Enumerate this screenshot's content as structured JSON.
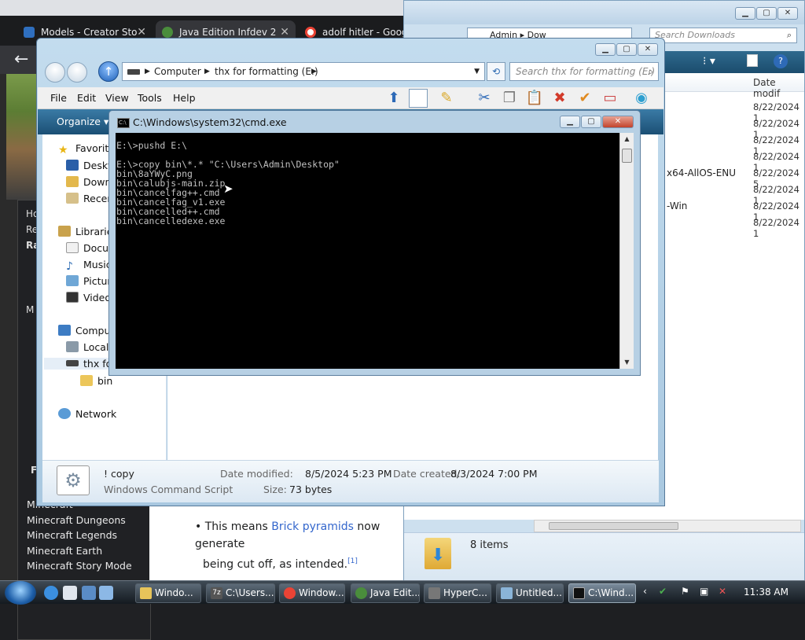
{
  "browser": {
    "tabs": [
      {
        "title": "Models - Creator Sto",
        "color": "#2f6fbf"
      },
      {
        "title": "Java Edition Infdev 2",
        "color": "#4a8d3c"
      },
      {
        "title": "adolf hitler - Googl",
        "color": "#ea4335"
      }
    ],
    "sidebar_fragments": [
      "Ho",
      "Re",
      "Ra",
      "M",
      "F"
    ],
    "sidebar_links": [
      "Minecraft",
      "Minecraft Dungeons",
      "Minecraft Legends",
      "Minecraft Earth",
      "Minecraft Story Mode"
    ],
    "article": {
      "bullet_prefix": "This means ",
      "link": "Brick pyramids",
      "bullet_suffix": " now generate",
      "line2": "being cut off, as intended.",
      "ref": "[1]"
    }
  },
  "downloads": {
    "address": [
      "Admin",
      "Dow"
    ],
    "search_placeholder": "Search Downloads",
    "column_date": "Date modif",
    "dates": [
      "8/22/2024 1",
      "8/22/2024 1",
      "8/22/2024 1",
      "8/22/2024 1",
      "8/22/2024 5",
      "8/22/2024 1",
      "8/22/2024 1",
      "8/22/2024 1"
    ],
    "name_fragments": {
      "row5": "x64-AllOS-ENU",
      "row7": "-Win"
    },
    "status": "8 items"
  },
  "explorer": {
    "breadcrumb": [
      "Computer",
      "thx for formatting (E:)"
    ],
    "search_placeholder": "Search thx for formatting (E:)",
    "menu": [
      "File",
      "Edit",
      "View",
      "Tools",
      "Help"
    ],
    "organize": "Organize",
    "nav": {
      "favorites": "Favorites",
      "favorites_items": [
        "Desktop",
        "Downloads",
        "Recent Places"
      ],
      "libraries": "Libraries",
      "libraries_items": [
        "Documents",
        "Music",
        "Pictures",
        "Videos"
      ],
      "computer": "Computer",
      "computer_items": [
        "Local Disk (C:)",
        "thx for formatting (E:)"
      ],
      "folder": "bin",
      "network": "Network"
    },
    "details": {
      "name": "! copy",
      "type": "Windows Command Script",
      "modified_label": "Date modified:",
      "modified_value": "8/5/2024 5:23 PM",
      "created_label": "Date created:",
      "created_value": "8/3/2024 7:00 PM",
      "size_label": "Size:",
      "size_value": "73 bytes"
    }
  },
  "cmd": {
    "title": "C:\\Windows\\system32\\cmd.exe",
    "lines": [
      "E:\\>pushd E:\\",
      "",
      "E:\\>copy bin\\*.* \"C:\\Users\\Admin\\Desktop\"",
      "bin\\8aYWyC.png",
      "bin\\calubjs-main.zip",
      "bin\\cancelfag++.cmd",
      "bin\\cancelfag_v1.exe",
      "bin\\cancelled++.cmd",
      "bin\\cancelledexe.exe"
    ]
  },
  "taskbar": {
    "tasks": [
      {
        "label": "Windo...",
        "color": "#e7c45a"
      },
      {
        "label": "C:\\Users...",
        "color": "#555"
      },
      {
        "label": "Window...",
        "color": "#ea4335"
      },
      {
        "label": "Java Edit...",
        "color": "#4a8d3c"
      },
      {
        "label": "HyperC...",
        "color": "#777"
      },
      {
        "label": "Untitled...",
        "color": "#8ab4d8"
      },
      {
        "label": "C:\\Wind...",
        "color": "#111"
      }
    ],
    "time": "11:38 AM"
  }
}
